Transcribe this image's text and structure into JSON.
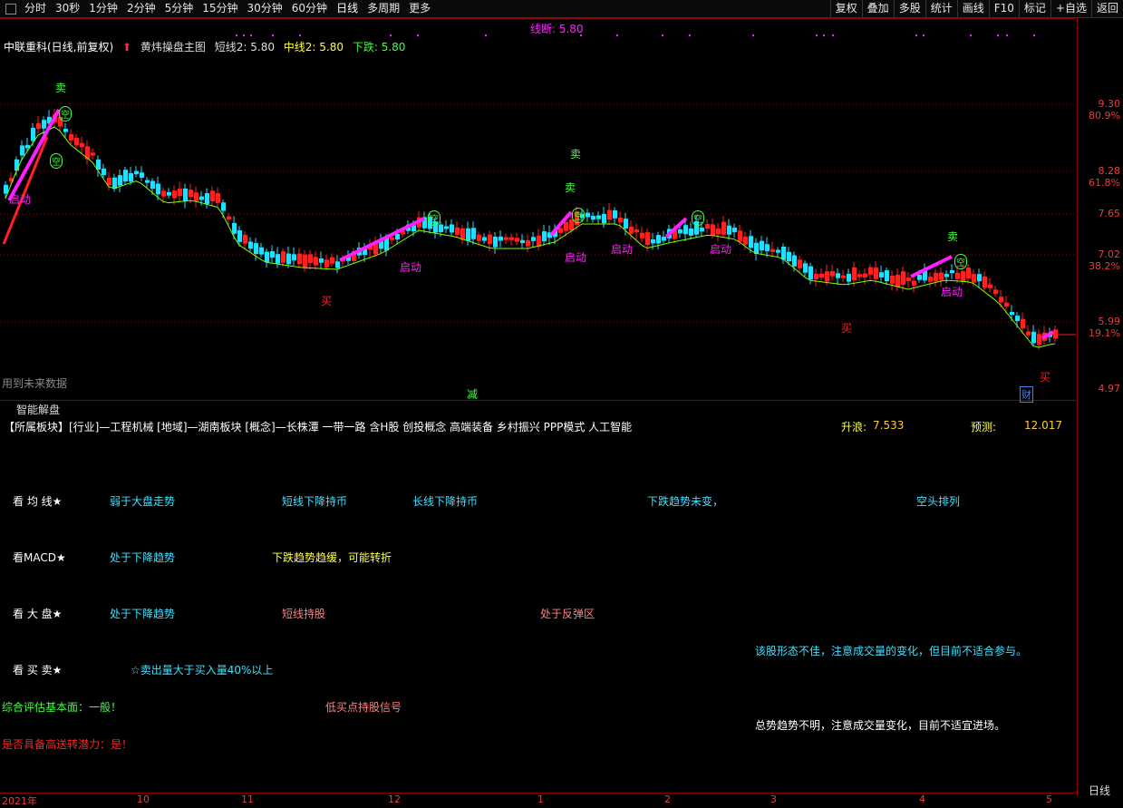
{
  "toolbar": {
    "items": [
      "分时",
      "30秒",
      "1分钟",
      "2分钟",
      "5分钟",
      "15分钟",
      "30分钟",
      "60分钟",
      "日线",
      "多周期",
      "更多"
    ],
    "right_items": [
      "复权",
      "叠加",
      "多股",
      "统计",
      "画线",
      "F10",
      "标记",
      "+自选",
      "返回"
    ]
  },
  "header": {
    "stock": "中联重科(日线,前复权)",
    "indicator": "黄炜操盘主图",
    "short_label": "短线2: 5.80",
    "mid_label": "中线2: 5.80",
    "down_label": "下跌: 5.80",
    "break_label": "线断: 5.80"
  },
  "chart": {
    "price_ticks": [
      "9.30",
      "8.28",
      "7.65",
      "7.02",
      "5.99",
      "4.97"
    ],
    "pct_ticks": [
      "80.9%",
      "61.8%",
      "38.2%",
      "19.1%"
    ],
    "future_note": "用到未来数据",
    "markers": {
      "sell": "卖",
      "buy": "买",
      "start": "启动",
      "empty": "空",
      "reduce": "减",
      "finance": "财"
    },
    "colors": {
      "up": "#ff2020",
      "down": "#20e0ff",
      "ma": "#7fff00",
      "pink": "#ff20ff"
    }
  },
  "panel": {
    "title": "智能解盘",
    "sector": "【所属板块】[行业]—工程机械 [地域]—湖南板块 [概念]—长株潭 一带一路 含H股 创投概念 高端装备 乡村振兴 PPP模式 人工智能",
    "rise_label": "升浪:",
    "rise_value": "7.533",
    "forecast_label": "预测:",
    "forecast_value": "12.017",
    "ma_row": {
      "label": "看 均 线★",
      "c1": "弱于大盘走势",
      "c2": "短线下降持币",
      "c3": "长线下降持币",
      "c4": "下跌趋势未变，",
      "c5": "空头排列"
    },
    "macd_row": {
      "label": "看MACD★",
      "c1": "处于下降趋势",
      "c2": "下跌趋势趋缓，可能转折"
    },
    "market_row": {
      "label": "看 大 盘★",
      "c1": "处于下降趋势",
      "c2": "短线持股",
      "c3": "处于反弹区"
    },
    "note1": "该股形态不佳，注意成交量的变化，但目前不适合参与。",
    "trade_row": {
      "label": "看 买 卖★",
      "c1": "☆卖出量大于买入量40%以上"
    },
    "fundamental": "综合评估基本面：一般！",
    "low_buy": "低买点持股信号",
    "high_transfer": "是否具备高送转潜力：是！",
    "note2": "总势趋势不明，注意成交量变化，目前不适宜进场。"
  },
  "dates": [
    "2021年",
    "10",
    "11",
    "12",
    "1",
    "2",
    "3",
    "4",
    "5"
  ],
  "period_label": "日线"
}
